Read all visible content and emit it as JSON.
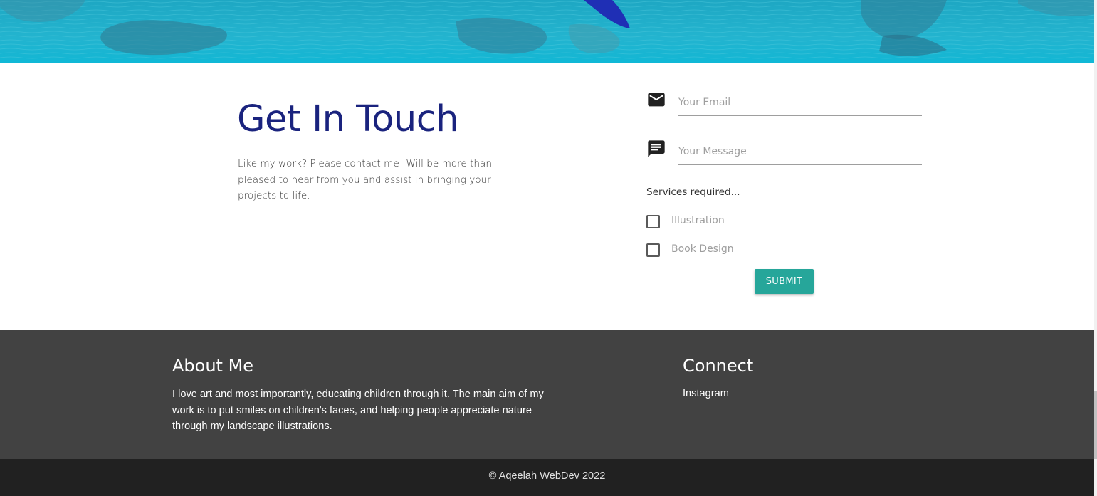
{
  "contact": {
    "title": "Get In Touch",
    "text": "Like my work? Please contact me! Will be more than pleased to hear from you and assist in bringing your projects to life.",
    "email_placeholder": "Your Email",
    "message_placeholder": "Your Message",
    "email_icon": "mail-icon",
    "message_icon": "message-icon",
    "services_label": "Services required...",
    "services": [
      "Illustration",
      "Book Design"
    ],
    "submit_label": "SUBMIT",
    "submit_color": "#26a69a",
    "title_color": "#1a237e"
  },
  "footer": {
    "about_title": "About Me",
    "about_text": "I love art and most importantly, educating children through it. The main aim of my work is to put smiles on children's faces, and helping people appreciate nature through my landscape illustrations.",
    "connect_title": "Connect",
    "connect_links": [
      "Instagram"
    ],
    "copyright": "© Aqeelah WebDev 2022",
    "background": "#424242",
    "copyright_background": "#212121"
  }
}
